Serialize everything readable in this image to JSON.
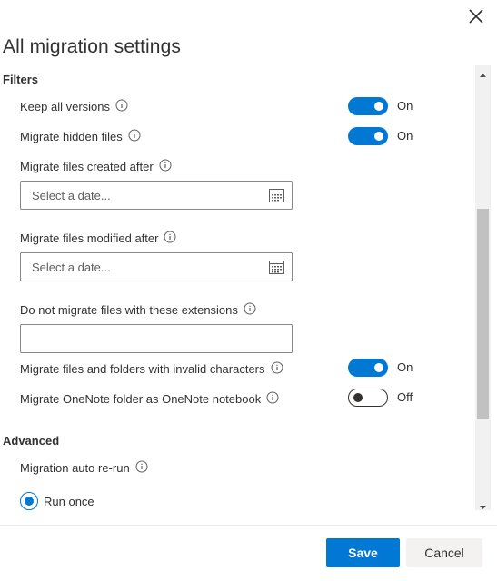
{
  "panel": {
    "title": "All migration settings"
  },
  "filters": {
    "heading": "Filters",
    "keep_all_versions": {
      "label": "Keep all versions",
      "state": "On",
      "enabled": true
    },
    "migrate_hidden_files": {
      "label": "Migrate hidden files",
      "state": "On",
      "enabled": true
    },
    "created_after": {
      "label": "Migrate files created after",
      "placeholder": "Select a date..."
    },
    "modified_after": {
      "label": "Migrate files modified after",
      "placeholder": "Select a date..."
    },
    "extensions": {
      "label": "Do not migrate files with these extensions",
      "value": ""
    },
    "invalid_chars": {
      "label": "Migrate files and folders with invalid characters",
      "state": "On",
      "enabled": true
    },
    "onenote": {
      "label": "Migrate OneNote folder as OneNote notebook",
      "state": "Off",
      "enabled": false
    }
  },
  "advanced": {
    "heading": "Advanced",
    "auto_rerun": {
      "label": "Migration auto re-run"
    },
    "run_once": {
      "label": "Run once",
      "selected": true
    }
  },
  "footer": {
    "save_label": "Save",
    "cancel_label": "Cancel"
  },
  "colors": {
    "accent": "#0078d4",
    "text": "#323130",
    "border": "#8a8886"
  },
  "icons": {
    "close": "close-icon",
    "info": "info-icon",
    "calendar": "calendar-icon"
  }
}
